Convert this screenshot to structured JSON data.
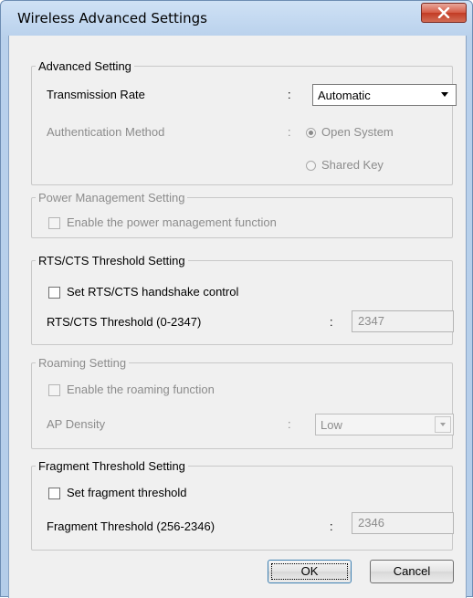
{
  "window": {
    "title": "Wireless Advanced Settings",
    "close_icon": "close-x-icon"
  },
  "advanced": {
    "legend": "Advanced Setting",
    "transmission_rate_label": "Transmission Rate",
    "transmission_rate_value": "Automatic",
    "auth_method_label": "Authentication Method",
    "auth_open_system": "Open System",
    "auth_shared_key": "Shared Key",
    "colon": ":"
  },
  "power": {
    "legend": "Power Management Setting",
    "enable_label": "Enable the power management function"
  },
  "rts": {
    "legend": "RTS/CTS Threshold Setting",
    "set_label": "Set RTS/CTS handshake control",
    "threshold_label": "RTS/CTS Threshold (0-2347)",
    "threshold_value": "2347",
    "colon": ":"
  },
  "roaming": {
    "legend": "Roaming Setting",
    "enable_label": "Enable the roaming function",
    "ap_density_label": "AP Density",
    "ap_density_value": "Low",
    "colon": ":"
  },
  "fragment": {
    "legend": "Fragment Threshold Setting",
    "set_label": "Set fragment threshold",
    "threshold_label": "Fragment Threshold (256-2346)",
    "threshold_value": "2346",
    "colon": ":"
  },
  "buttons": {
    "ok": "OK",
    "cancel": "Cancel"
  }
}
